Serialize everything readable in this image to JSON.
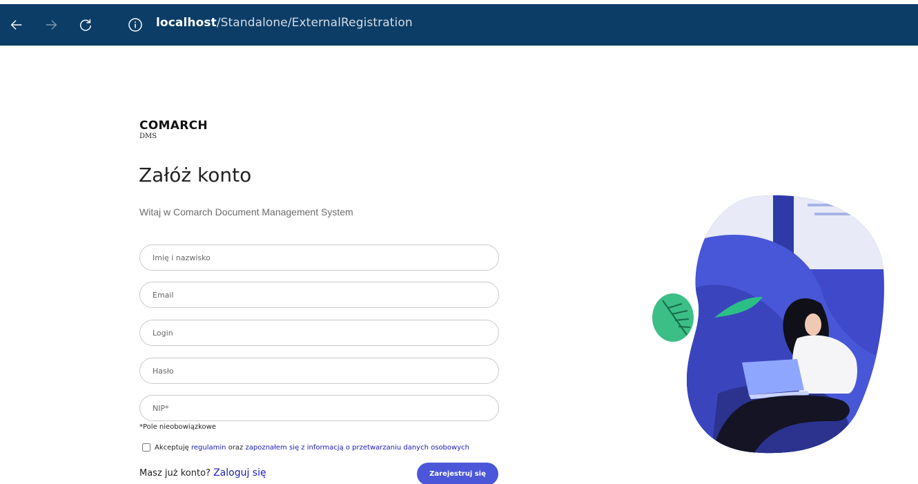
{
  "browser": {
    "url_host": "localhost",
    "url_path": "/Standalone/ExternalRegistration"
  },
  "brand": {
    "name": "COMARCH",
    "product": "DMS"
  },
  "page": {
    "title": "Załóż konto",
    "subtitle": "Witaj w Comarch Document Management System"
  },
  "form": {
    "name_placeholder": "Imię i nazwisko",
    "email_placeholder": "Email",
    "login_placeholder": "Login",
    "password_placeholder": "Hasło",
    "nip_placeholder": "NIP*",
    "optional_note": "*Pole nieobowiązkowe",
    "consent_prefix": "Akceptuję",
    "consent_terms_link": "regulamin",
    "consent_middle": "oraz",
    "consent_privacy_link": "zapoznałem się z informacją o przetwarzaniu danych osobowych",
    "consent_checked": false,
    "have_account_text": "Masz już konto?",
    "login_link": "Zaloguj się",
    "register_button": "Zarejestruj się"
  },
  "colors": {
    "browser_bar": "#0b3d66",
    "accent": "#4b57d8",
    "link": "#1a1ab8"
  }
}
